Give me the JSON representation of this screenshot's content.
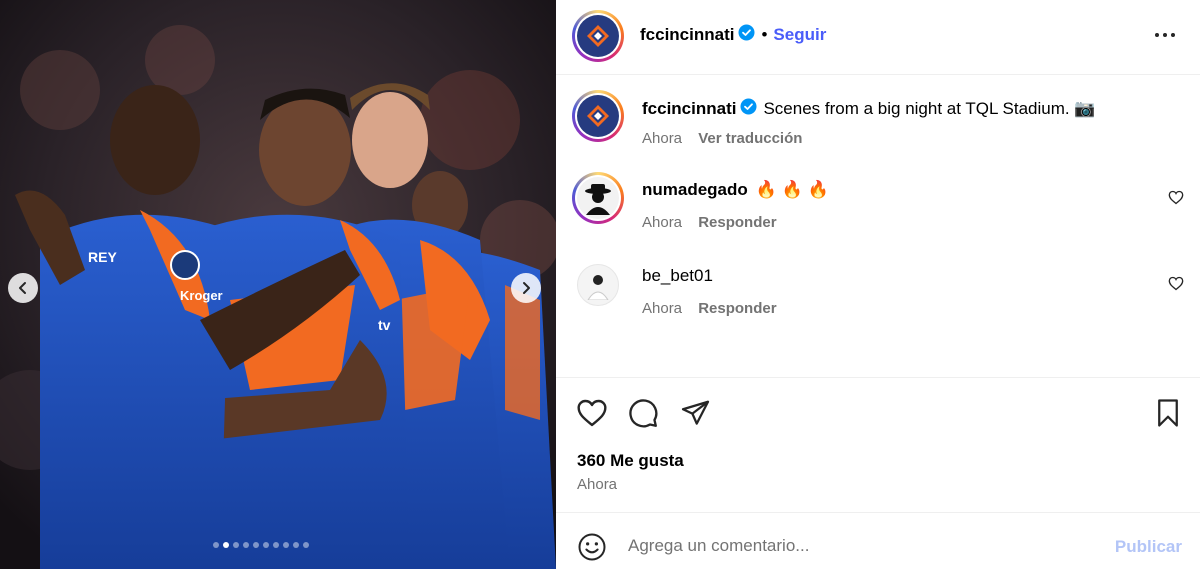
{
  "post": {
    "author": "fccincinnati",
    "follow_label": "Seguir",
    "separator": "•",
    "caption": "Scenes from a big night at TQL Stadium. 📷",
    "caption_time": "Ahora",
    "translate_label": "Ver traducción",
    "likes": "360 Me gusta",
    "time": "Ahora"
  },
  "carousel": {
    "current_index": 2,
    "total": 10
  },
  "comments": [
    {
      "username": "numadegado",
      "text": "🔥 🔥 🔥",
      "time": "Ahora",
      "reply_label": "Responder"
    },
    {
      "username": "be_bet01",
      "text": "",
      "time": "Ahora",
      "reply_label": "Responder"
    }
  ],
  "add_comment": {
    "placeholder": "Agrega un comentario...",
    "publish_label": "Publicar"
  },
  "colors": {
    "follow": "#4a5df9",
    "publish_disabled": "#b3c5f7",
    "kit_blue": "#1e4bb5",
    "kit_orange": "#f26a21",
    "verified": "#0095f6"
  },
  "icons": [
    "verified-icon",
    "more-options-icon",
    "heart-icon",
    "comment-icon",
    "share-icon",
    "bookmark-icon",
    "emoji-icon",
    "chevron-left-icon",
    "chevron-right-icon"
  ]
}
